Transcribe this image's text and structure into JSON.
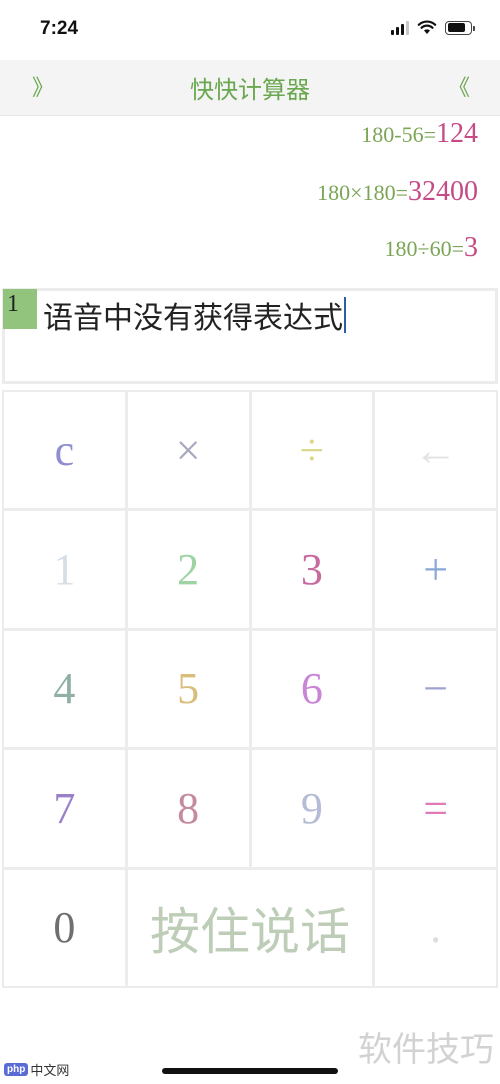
{
  "status_bar": {
    "time": "7:24"
  },
  "header": {
    "left_button": "》",
    "title": "快快计算器",
    "right_button": "《"
  },
  "history": [
    {
      "expression": "180-56=",
      "result": "124"
    },
    {
      "expression": "180×180=",
      "result": "32400"
    },
    {
      "expression": "180÷60=",
      "result": "3"
    }
  ],
  "input": {
    "line_number": "1",
    "text": "语音中没有获得表达式"
  },
  "keypad": {
    "keys": [
      {
        "label": "c",
        "color": "#8e8ed0"
      },
      {
        "label": "×",
        "color": "#a9a9bf"
      },
      {
        "label": "÷",
        "color": "#d9d98c"
      },
      {
        "label": "←",
        "color": "#e3e3e3"
      },
      {
        "label": "1",
        "color": "#d6dfe6"
      },
      {
        "label": "2",
        "color": "#9ed3a4"
      },
      {
        "label": "3",
        "color": "#c86aa0"
      },
      {
        "label": "+",
        "color": "#8aa8d6"
      },
      {
        "label": "4",
        "color": "#8fb0a2"
      },
      {
        "label": "5",
        "color": "#d9bd7a"
      },
      {
        "label": "6",
        "color": "#c985d6"
      },
      {
        "label": "−",
        "color": "#9fa3cf"
      },
      {
        "label": "7",
        "color": "#9a80c9"
      },
      {
        "label": "8",
        "color": "#c48aa0"
      },
      {
        "label": "9",
        "color": "#b5bcd6"
      },
      {
        "label": "=",
        "color": "#e07ab8"
      },
      {
        "label": "0",
        "color": "#6f6f6f"
      },
      {
        "label": "按住说话",
        "color": "#bdcdb7"
      },
      {
        "label": ".",
        "color": "#dddddd"
      }
    ]
  },
  "watermark": {
    "text": "软件技巧",
    "logo_badge": "php",
    "logo_site": "中文网"
  }
}
